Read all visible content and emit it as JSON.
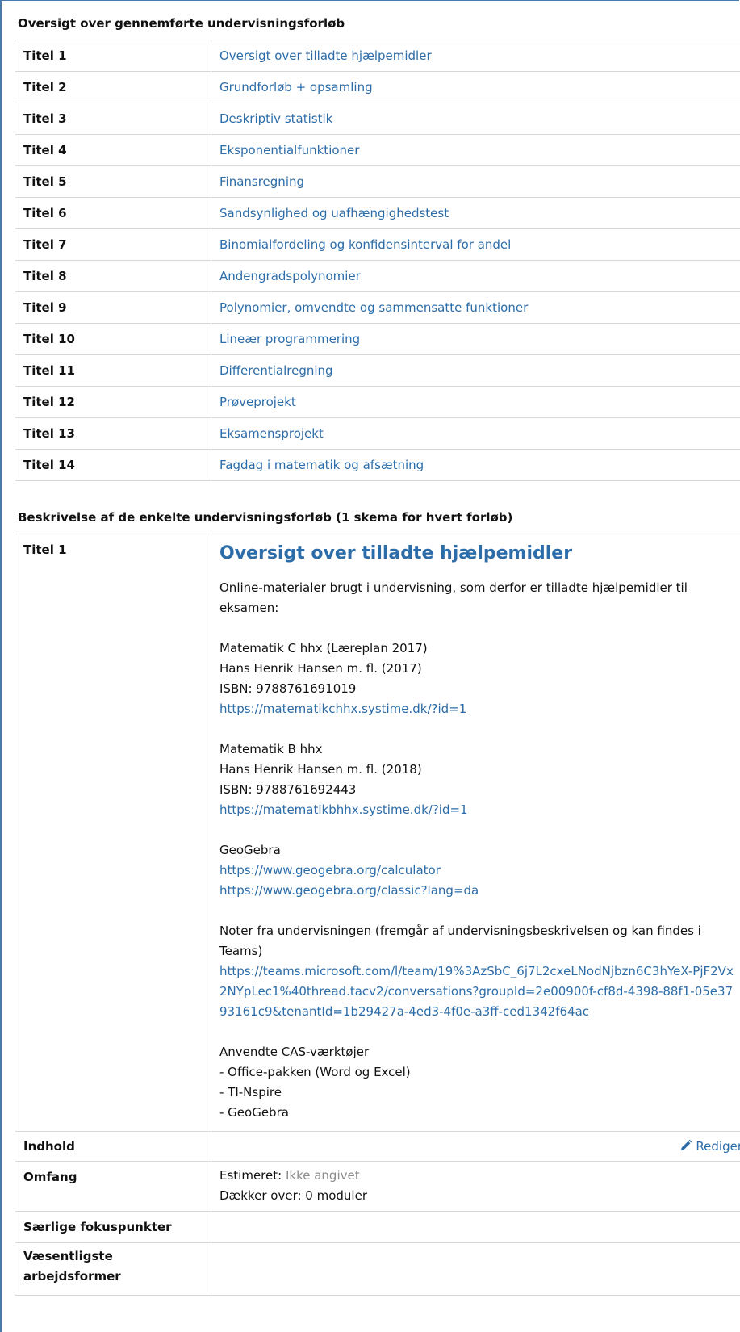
{
  "overview": {
    "heading": "Oversigt over gennemførte undervisningsforløb",
    "rows": [
      {
        "label": "Titel 1",
        "title": "Oversigt over tilladte hjælpemidler"
      },
      {
        "label": "Titel 2",
        "title": "Grundforløb + opsamling"
      },
      {
        "label": "Titel 3",
        "title": "Deskriptiv statistik"
      },
      {
        "label": "Titel 4",
        "title": "Eksponentialfunktioner"
      },
      {
        "label": "Titel 5",
        "title": "Finansregning"
      },
      {
        "label": "Titel 6",
        "title": "Sandsynlighed og uafhængighedstest"
      },
      {
        "label": "Titel 7",
        "title": "Binomialfordeling og konfidensinterval for andel"
      },
      {
        "label": "Titel 8",
        "title": "Andengradspolynomier"
      },
      {
        "label": "Titel 9",
        "title": "Polynomier, omvendte og sammensatte funktioner"
      },
      {
        "label": "Titel 10",
        "title": "Lineær programmering"
      },
      {
        "label": "Titel 11",
        "title": "Differentialregning"
      },
      {
        "label": "Titel 12",
        "title": "Prøveprojekt"
      },
      {
        "label": "Titel 13",
        "title": "Eksamensprojekt"
      },
      {
        "label": "Titel 14",
        "title": "Fagdag i matematik og afsætning"
      }
    ]
  },
  "details": {
    "heading": "Beskrivelse af de enkelte undervisningsforløb (1 skema for hvert forløb)",
    "label": "Titel 1",
    "title": "Oversigt over tilladte hjælpemidler",
    "intro": "Online-materialer brugt i undervisning, som derfor er tilladte hjælpemidler til eksamen:",
    "book_c": {
      "name": "Matematik C hhx (Læreplan 2017)",
      "author": "Hans Henrik Hansen m. fl. (2017)",
      "isbn": "ISBN: 9788761691019",
      "url": "https://matematikchhx.systime.dk/?id=1"
    },
    "book_b": {
      "name": "Matematik B hhx",
      "author": "Hans Henrik Hansen m. fl. (2018)",
      "isbn": "ISBN: 9788761692443",
      "url": "https://matematikbhhx.systime.dk/?id=1"
    },
    "geogebra": {
      "name": "GeoGebra",
      "url1": "https://www.geogebra.org/calculator",
      "url2": "https://www.geogebra.org/classic?lang=da"
    },
    "notes": {
      "text": "Noter fra undervisningen (fremgår af undervisningsbeskrivelsen og kan findes i Teams)",
      "url": "https://teams.microsoft.com/l/team/19%3AzSbC_6j7L2cxeLNodNjbzn6C3hYeX-PjF2Vx2NYpLec1%40thread.tacv2/conversations?groupId=2e00900f-cf8d-4398-88f1-05e3793161c9&tenantId=1b29427a-4ed3-4f0e-a3ff-ced1342f64ac"
    },
    "cas": {
      "heading": "Anvendte CAS-værktøjer",
      "items": [
        "- Office-pakken (Word og Excel)",
        "- TI-Nspire",
        "- GeoGebra"
      ]
    },
    "indhold_label": "Indhold",
    "edit_label": "Rediger",
    "edit_icon": "pencil-icon",
    "omfang_label": "Omfang",
    "estimeret_label": "Estimeret:",
    "estimeret_value": "Ikke angivet",
    "daekker": "Dækker over: 0 moduler",
    "fokus_label": "Særlige fokuspunkter",
    "arbejdsformer_label": "Væsentligste arbejdsformer"
  },
  "colors": {
    "link": "#2c6ca8",
    "border": "#d7d7d7",
    "frame": "#4a7aaa",
    "muted": "#8c8c8c"
  }
}
